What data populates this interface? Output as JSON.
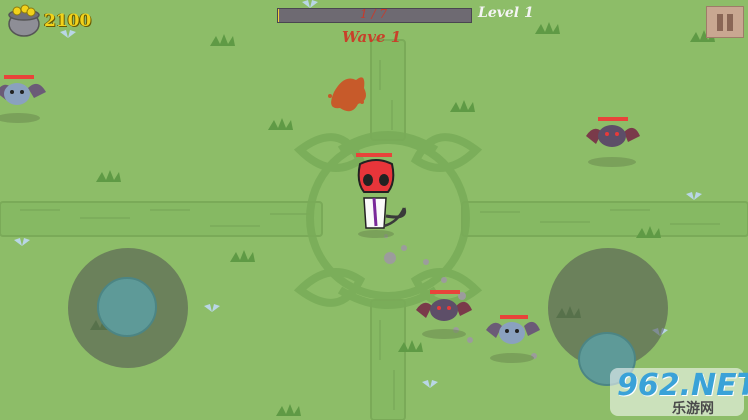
{
  "hud": {
    "gold_icon": "coin-pot-icon",
    "gold_amount": "2100",
    "wave_progress_text": "1 / 7",
    "wave_progress_current": 1,
    "wave_progress_total": 7,
    "level_text": "Level 1",
    "wave_text": "Wave 1",
    "pause_icon": "pause-icon"
  },
  "colors": {
    "grass": "#8dbd68",
    "path": "#7fb15c",
    "gold_text": "#f2d21a",
    "wave_text": "#c8402a",
    "xp_fill": "#f1d23a",
    "health_red": "#e8443a",
    "bat_body": "#5d4e68",
    "skull_red": "#e8353a"
  },
  "watermark": {
    "brand": "962.NET",
    "sub": "乐游网"
  }
}
